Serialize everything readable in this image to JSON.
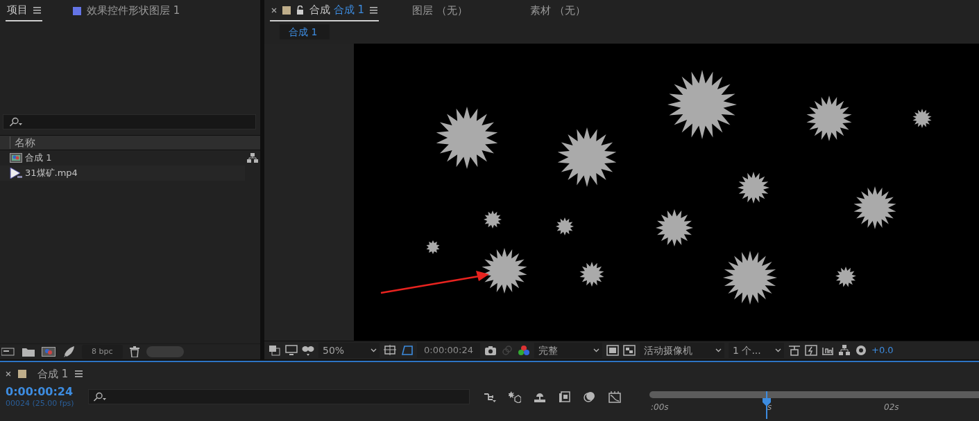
{
  "project_panel": {
    "tabs": [
      {
        "label": "项目",
        "selected": true,
        "kind": "menu"
      },
      {
        "label": "效果控件形状图层 1",
        "selected": false,
        "kind": "swatch"
      }
    ],
    "column_header": "名称",
    "items": [
      {
        "name": "合成 1",
        "kind": "composition"
      },
      {
        "name": "31煤矿.mp4",
        "kind": "footage"
      }
    ],
    "bit_depth": "8 bpc"
  },
  "viewer_panel": {
    "tabs": [
      {
        "prefix": "合成",
        "label": "合成 1",
        "selected": true
      },
      {
        "label": "图层 （无）",
        "selected": false
      },
      {
        "label": "素材 （无）",
        "selected": false
      }
    ],
    "breadcrumb": "合成 1",
    "zoom": "50%",
    "timecode": "0:00:00:24",
    "resolution": "完整",
    "camera": "活动摄像机",
    "views": "1 个...",
    "exposure": "+0.0"
  },
  "timeline": {
    "title": "合成 1",
    "timecode": "0:00:00:24",
    "frame_info": "00024 (25.00 fps)",
    "ruler": [
      ":00s",
      "s",
      "02s"
    ],
    "playhead": {
      "level": 0.355
    }
  }
}
